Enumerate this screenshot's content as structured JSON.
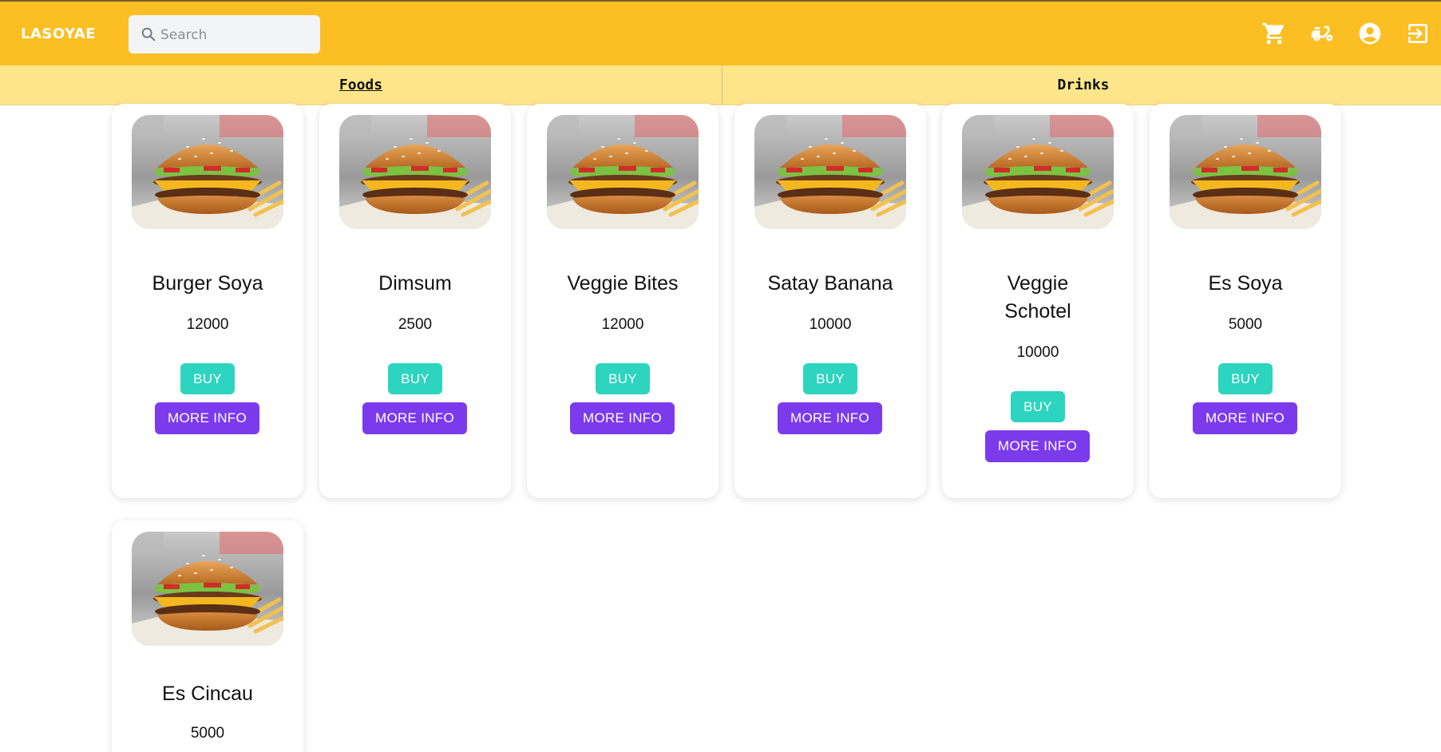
{
  "header": {
    "brand": "LASOYAE",
    "search_placeholder": "Search",
    "icons": [
      "cart-icon",
      "scooter-icon",
      "account-icon",
      "logout-icon"
    ]
  },
  "tabs": [
    {
      "label": "Foods",
      "active": true
    },
    {
      "label": "Drinks",
      "active": false
    }
  ],
  "products": [
    {
      "name": "Burger Soya",
      "price": "12000"
    },
    {
      "name": "Dimsum",
      "price": "2500"
    },
    {
      "name": "Veggie Bites",
      "price": "12000"
    },
    {
      "name": "Satay Banana",
      "price": "10000"
    },
    {
      "name": "Veggie Schotel",
      "price": "10000"
    },
    {
      "name": "Es Soya",
      "price": "5000"
    },
    {
      "name": "Es Cincau",
      "price": "5000"
    }
  ],
  "buttons": {
    "buy_label": "BUY",
    "info_label": "MORE INFO"
  },
  "colors": {
    "header": "#fbbf24",
    "tabs": "#fde68a",
    "buy": "#2dd4bf",
    "more_info": "#7c3aed"
  }
}
